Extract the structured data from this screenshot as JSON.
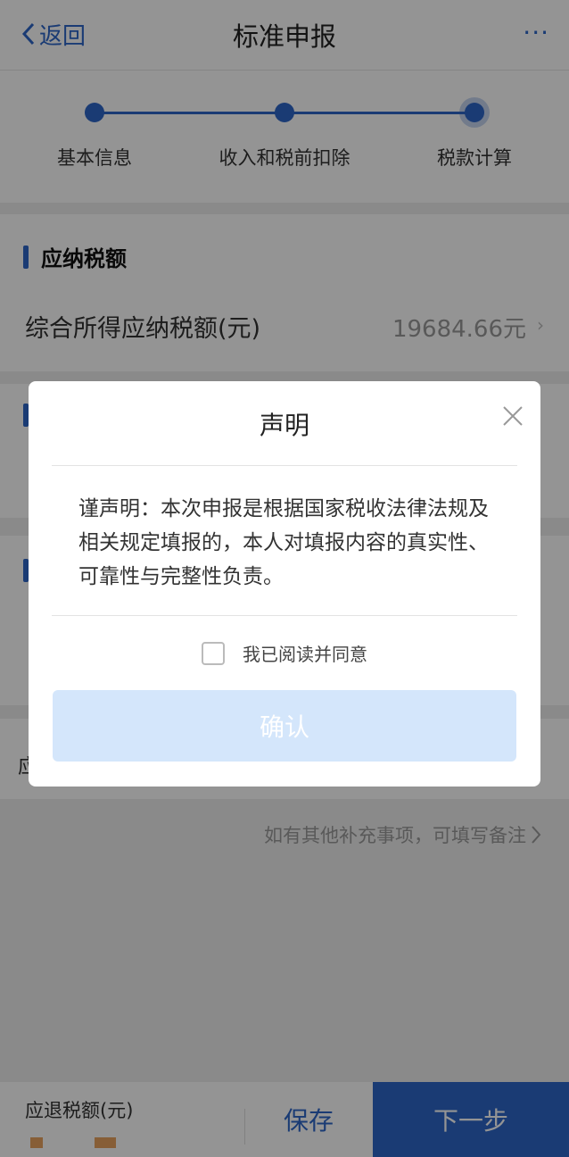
{
  "header": {
    "back_label": "返回",
    "title": "标准申报",
    "more_label": "···"
  },
  "steps": [
    {
      "label": "基本信息"
    },
    {
      "label": "收入和税前扣除"
    },
    {
      "label": "税款计算"
    }
  ],
  "section_tax": {
    "title": "应纳税额",
    "row_label": "综合所得应纳税额(元)",
    "row_value": "19684.66元"
  },
  "partial_texts": {
    "section3_row_char": "应"
  },
  "note": {
    "text": "如有其他补充事项，可填写备注"
  },
  "footer": {
    "refund_label": "应退税额(元)",
    "save_label": "保存",
    "next_label": "下一步"
  },
  "modal": {
    "title": "声明",
    "body": "谨声明：本次申报是根据国家税收法律法规及相关规定填报的，本人对填报内容的真实性、可靠性与完整性负责。",
    "agree_label": "我已阅读并同意",
    "agree_checked": false,
    "confirm_label": "确认"
  },
  "colors": {
    "accent": "#2e67c9",
    "confirm_disabled": "#d4e6fb"
  }
}
